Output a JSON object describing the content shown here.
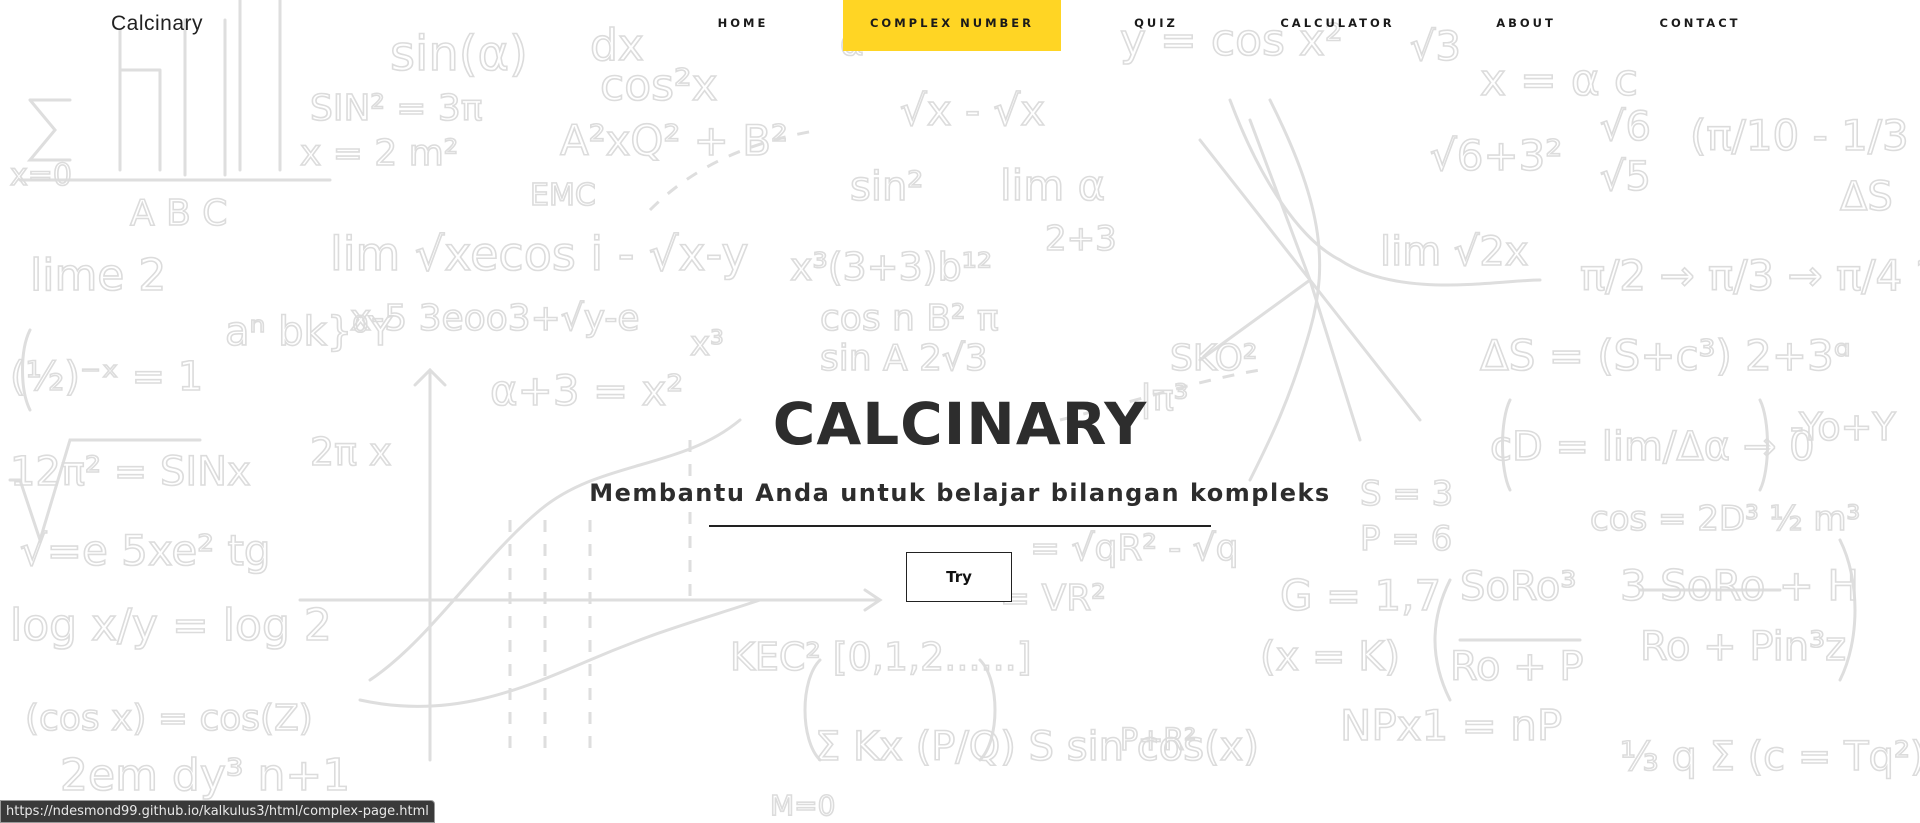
{
  "logo": "Calcinary",
  "nav": {
    "items": [
      {
        "label": "HOME"
      },
      {
        "label": "COMPLEX NUMBER"
      },
      {
        "label": "QUIZ"
      },
      {
        "label": "CALCULATOR"
      },
      {
        "label": "ABOUT"
      },
      {
        "label": "CONTACT"
      }
    ],
    "active_item": "COMPLEX NUMBER",
    "active_color": "#ffd524"
  },
  "hero": {
    "title": "CALCINARY",
    "subtitle": "Membantu Anda untuk belajar bilangan kompleks",
    "button_label": "Try"
  },
  "status_bar": {
    "url": "https://ndesmond99.github.io/kalkulus3/html/complex-page.html"
  },
  "background": {
    "motif": "math-formula-doodles",
    "doodle_color": "#dcdcdc"
  }
}
